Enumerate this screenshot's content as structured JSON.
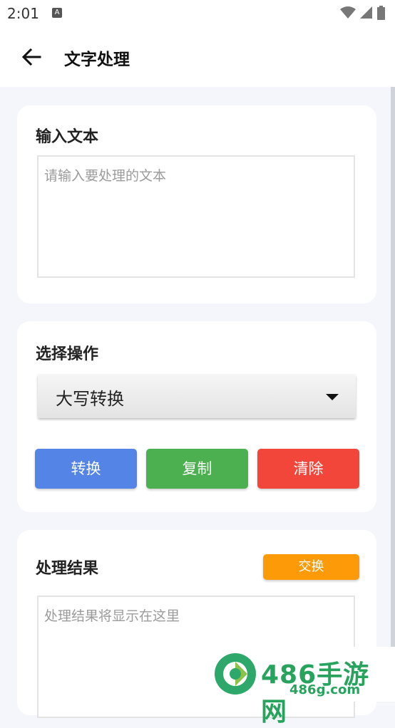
{
  "status_bar": {
    "time": "2:01",
    "notification_icon": "A"
  },
  "app_bar": {
    "title": "文字处理",
    "back_icon": "arrow-left-icon"
  },
  "input_section": {
    "title": "输入文本",
    "placeholder": "请输入要处理的文本",
    "value": ""
  },
  "operation_section": {
    "title": "选择操作",
    "selected_operation": "大写转换",
    "buttons": {
      "convert": "转换",
      "copy": "复制",
      "clear": "清除"
    }
  },
  "result_section": {
    "title": "处理结果",
    "swap_label": "交换",
    "placeholder": "处理结果将显示在这里"
  },
  "watermark": {
    "text": "486手游网",
    "sub": "486g.com"
  },
  "colors": {
    "convert": "#5384e6",
    "copy": "#4caf50",
    "clear": "#f2463a",
    "swap": "#fd9a07"
  }
}
